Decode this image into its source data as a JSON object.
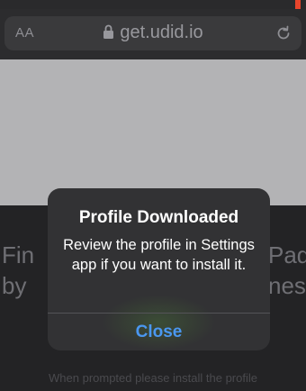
{
  "browser": {
    "text_size_button": "AA",
    "url": "get.udid.io",
    "lock_icon": "lock-icon",
    "reload_icon": "reload-icon"
  },
  "page": {
    "heading_left": "Fin\nby",
    "heading_right": "Pad\nnes",
    "bottom_text": "When prompted please install the profile"
  },
  "dialog": {
    "title": "Profile Downloaded",
    "message": "Review the profile in Settings app if you want to install it.",
    "close_label": "Close"
  },
  "colors": {
    "accent": "#4a97f0",
    "dialog_bg": "#323234"
  }
}
